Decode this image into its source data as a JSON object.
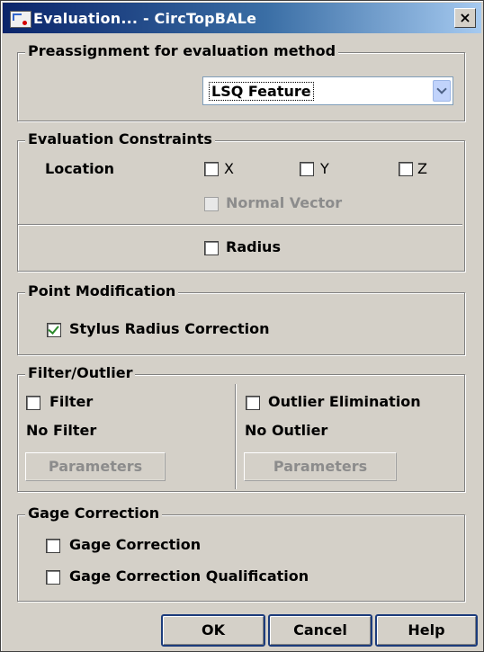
{
  "window": {
    "title": "Evaluation... - CircTopBALe",
    "close_label": "×"
  },
  "preassignment": {
    "legend": "Preassignment for evaluation method",
    "selected": "LSQ Feature"
  },
  "constraints": {
    "legend": "Evaluation Constraints",
    "location_label": "Location",
    "x_label": "X",
    "y_label": "Y",
    "z_label": "Z",
    "x_checked": false,
    "y_checked": false,
    "z_checked": false,
    "normal_vector_label": "Normal Vector",
    "normal_vector_enabled": false,
    "radius_label": "Radius",
    "radius_checked": false
  },
  "point_modification": {
    "legend": "Point Modification",
    "stylus_label": "Stylus Radius Correction",
    "stylus_checked": true
  },
  "filter_outlier": {
    "legend": "Filter/Outlier",
    "filter_label": "Filter",
    "filter_checked": false,
    "filter_status": "No Filter",
    "filter_params": "Parameters",
    "outlier_label": "Outlier Elimination",
    "outlier_checked": false,
    "outlier_status": "No Outlier",
    "outlier_params": "Parameters"
  },
  "gage_correction": {
    "legend": "Gage Correction",
    "gage_label": "Gage Correction",
    "gage_checked": false,
    "qual_label": "Gage Correction Qualification",
    "qual_checked": false
  },
  "buttons": {
    "ok": "OK",
    "cancel": "Cancel",
    "help": "Help"
  },
  "colors": {
    "titlebar_start": "#0a246a",
    "titlebar_end": "#a6caf0",
    "dialog_bg": "#d4d0c8",
    "check_green": "#2b8a2b"
  }
}
